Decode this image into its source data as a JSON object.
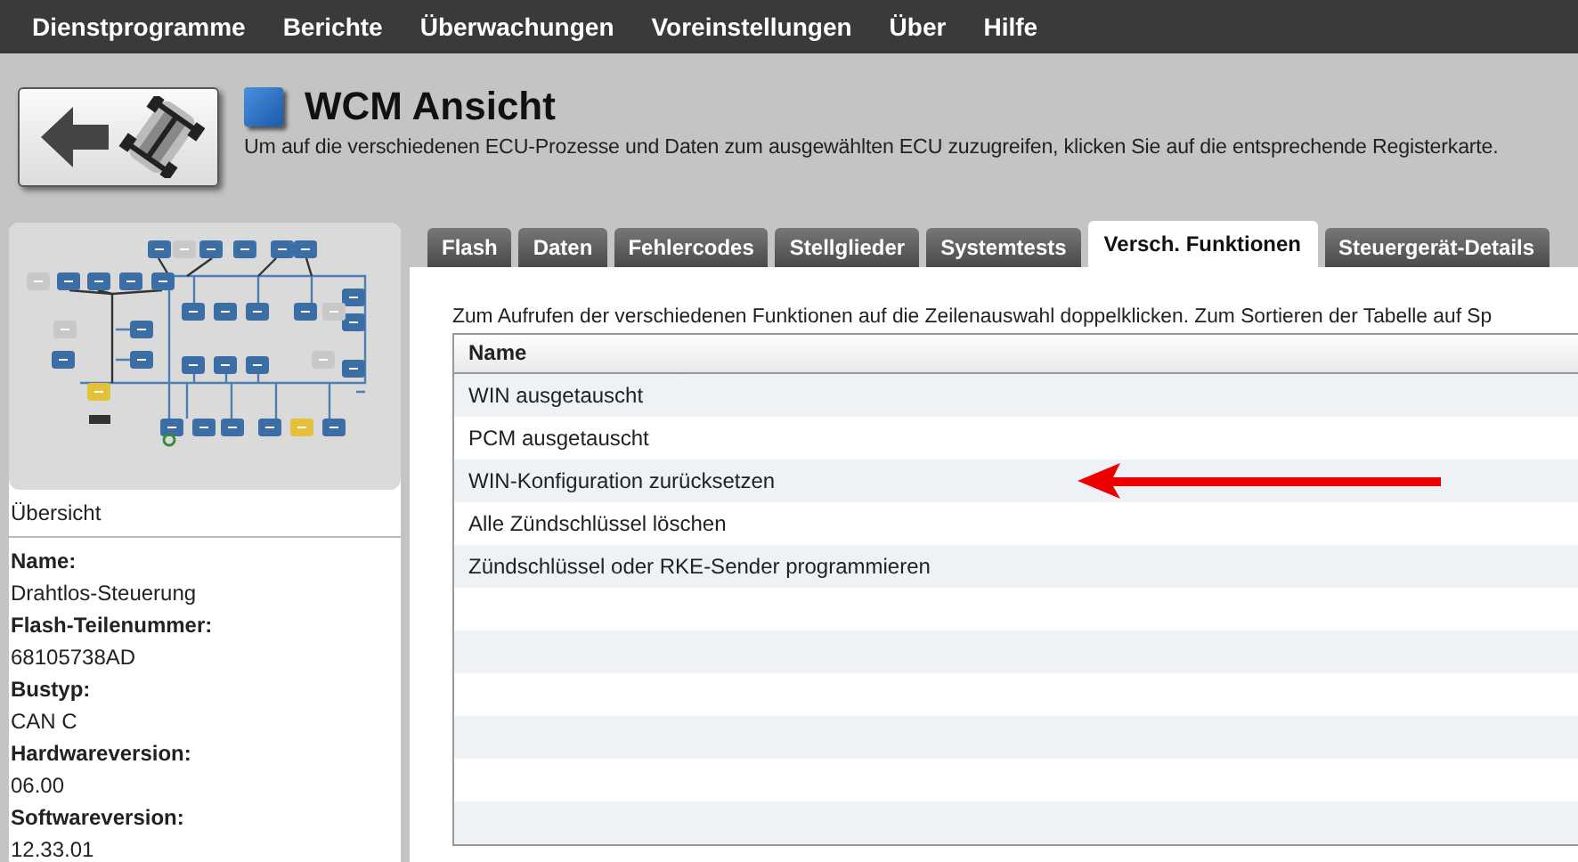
{
  "menu_bar": [
    "Dienstprogramme",
    "Berichte",
    "Überwachungen",
    "Voreinstellungen",
    "Über",
    "Hilfe"
  ],
  "header": {
    "title": "WCM Ansicht",
    "description": "Um auf die verschiedenen ECU-Prozesse und Daten zum ausgewählten ECU zuzugreifen, klicken Sie auf die entsprechende Registerkarte."
  },
  "sidebar": {
    "caption": "Übersicht",
    "fields": [
      {
        "label": "Name:",
        "value": "Drahtlos-Steuerung"
      },
      {
        "label": "Flash-Teilenummer:",
        "value": "68105738AD"
      },
      {
        "label": "Bustyp:",
        "value": "CAN C"
      },
      {
        "label": "Hardwareversion:",
        "value": "06.00"
      },
      {
        "label": "Softwareversion:",
        "value": "12.33.01"
      }
    ]
  },
  "tabs": [
    {
      "label": "Flash",
      "selected": false
    },
    {
      "label": "Daten",
      "selected": false
    },
    {
      "label": "Fehlercodes",
      "selected": false
    },
    {
      "label": "Stellglieder",
      "selected": false
    },
    {
      "label": "Systemtests",
      "selected": false
    },
    {
      "label": "Versch. Funktionen",
      "selected": true
    },
    {
      "label": "Steuergerät-Details",
      "selected": false
    }
  ],
  "instruction": "Zum Aufrufen der verschiedenen Funktionen auf die Zeilenauswahl doppelklicken.  Zum Sortieren der Tabelle auf Sp",
  "table": {
    "columns": [
      "Name"
    ],
    "rows": [
      "WIN ausgetauscht",
      "PCM ausgetauscht",
      "WIN-Konfiguration zurücksetzen",
      "Alle Zündschlüssel löschen",
      "Zündschlüssel oder RKE-Sender programmieren"
    ]
  }
}
